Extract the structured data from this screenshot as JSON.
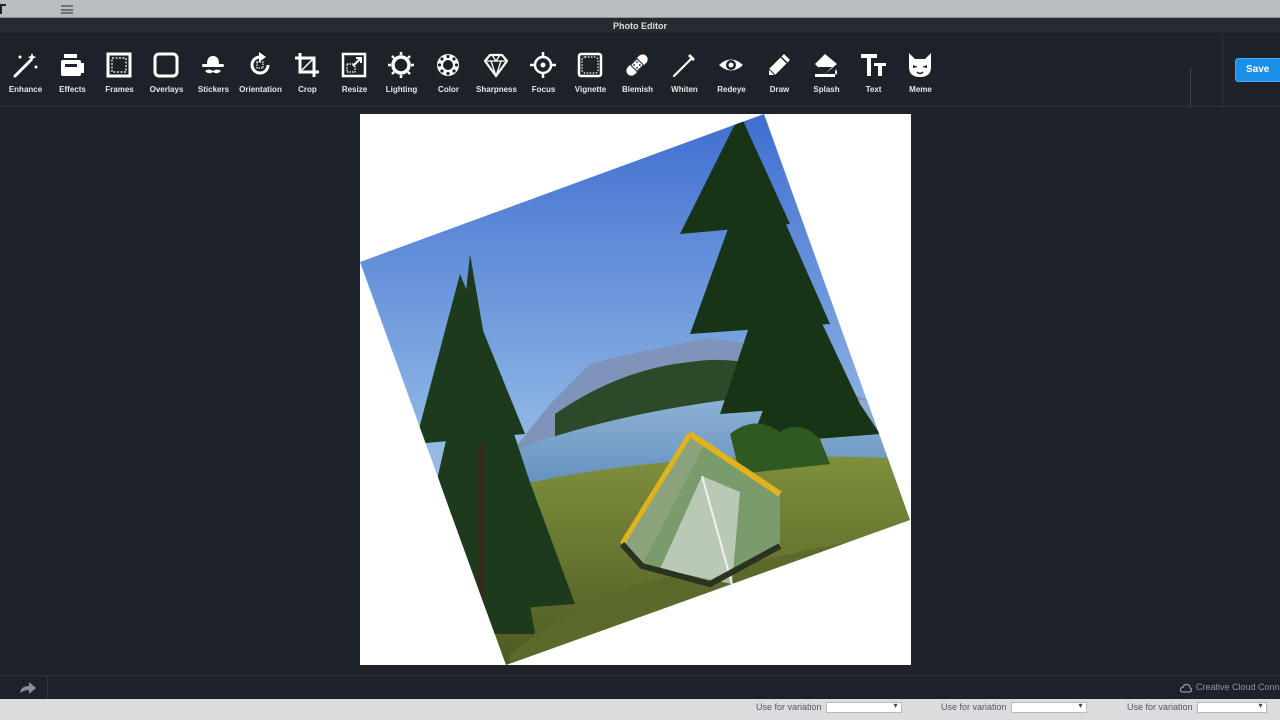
{
  "window": {
    "title": "Photo Editor"
  },
  "toolbar": {
    "tools": [
      {
        "label": "Enhance",
        "icon": "magic-wand-icon"
      },
      {
        "label": "Effects",
        "icon": "effects-icon"
      },
      {
        "label": "Frames",
        "icon": "frame-icon"
      },
      {
        "label": "Overlays",
        "icon": "overlay-icon"
      },
      {
        "label": "Stickers",
        "icon": "sticker-icon"
      },
      {
        "label": "Orientation",
        "icon": "rotate-icon"
      },
      {
        "label": "Crop",
        "icon": "crop-icon"
      },
      {
        "label": "Resize",
        "icon": "resize-icon"
      },
      {
        "label": "Lighting",
        "icon": "lighting-icon"
      },
      {
        "label": "Color",
        "icon": "color-icon"
      },
      {
        "label": "Sharpness",
        "icon": "diamond-icon"
      },
      {
        "label": "Focus",
        "icon": "focus-icon"
      },
      {
        "label": "Vignette",
        "icon": "vignette-icon"
      },
      {
        "label": "Blemish",
        "icon": "bandage-icon"
      },
      {
        "label": "Whiten",
        "icon": "whiten-icon"
      },
      {
        "label": "Redeye",
        "icon": "eye-icon"
      },
      {
        "label": "Draw",
        "icon": "pencil-icon"
      },
      {
        "label": "Splash",
        "icon": "splash-icon"
      },
      {
        "label": "Text",
        "icon": "text-icon"
      },
      {
        "label": "Meme",
        "icon": "meme-icon"
      }
    ],
    "save_label": "Save"
  },
  "status": {
    "cc_label": "Creative Cloud Conne"
  },
  "background_page": {
    "variation_label": "Use for variation",
    "variation_count": 3
  },
  "colors": {
    "accent": "#1a8fe8",
    "panel": "#1d2228",
    "canvas_bg": "#ffffff"
  }
}
